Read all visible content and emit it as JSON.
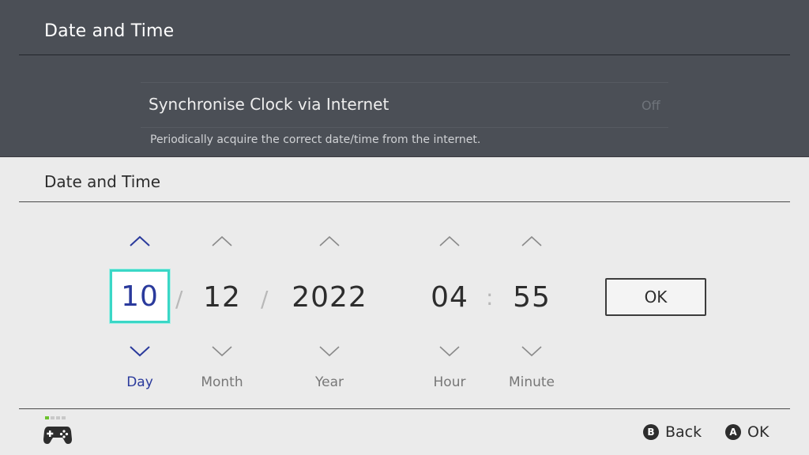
{
  "background": {
    "title": "Date and Time",
    "row_label": "Synchronise Clock via Internet",
    "row_value": "Off",
    "row_description": "Periodically acquire the correct date/time from the internet."
  },
  "dialog": {
    "title": "Date and Time",
    "fields": [
      {
        "label": "Day",
        "value": "10",
        "selected": true
      },
      {
        "label": "Month",
        "value": "12",
        "selected": false
      },
      {
        "label": "Year",
        "value": "2022",
        "selected": false
      },
      {
        "label": "Hour",
        "value": "04",
        "selected": false
      },
      {
        "label": "Minute",
        "value": "55",
        "selected": false
      }
    ],
    "date_separator": "/",
    "time_separator": ":",
    "ok_button": "OK"
  },
  "footer": {
    "controller_icon": "controller-icon",
    "back_glyph": "B",
    "back_label": "Back",
    "ok_glyph": "A",
    "ok_label": "OK"
  },
  "colors": {
    "highlight_border": "#3ad7c6",
    "selected_text": "#2a3a9c",
    "arrow": "#2a3a9c",
    "background_overlay": "#4b4f56"
  }
}
